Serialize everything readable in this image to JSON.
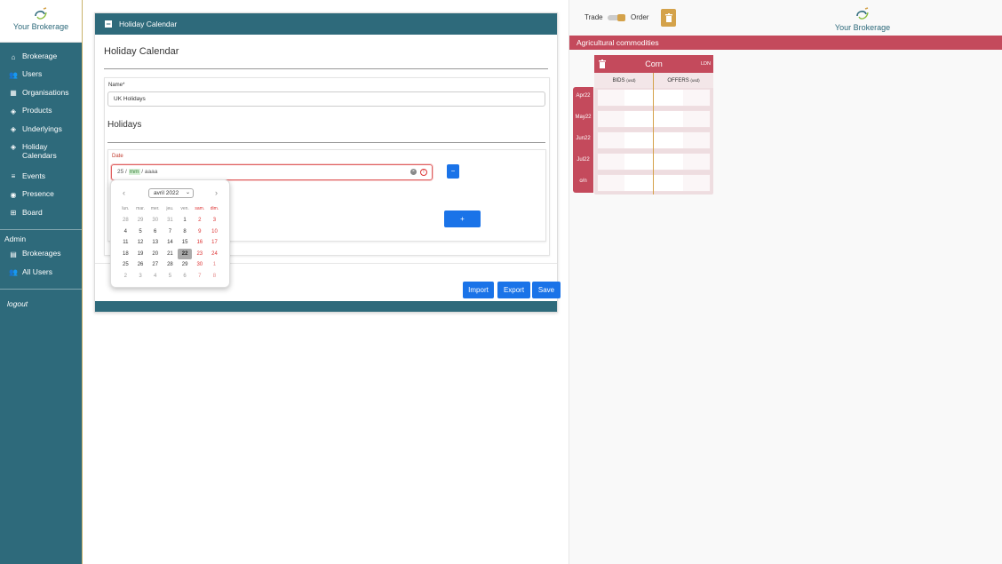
{
  "sidebar": {
    "brand": "Your Brokerage",
    "items": [
      {
        "label": "Brokerage",
        "icon": "home-icon"
      },
      {
        "label": "Users",
        "icon": "users-icon"
      },
      {
        "label": "Organisations",
        "icon": "building-icon"
      },
      {
        "label": "Products",
        "icon": "tag-icon"
      },
      {
        "label": "Underlyings",
        "icon": "tag-icon"
      },
      {
        "label": "Holiday Calendars",
        "icon": "calendar-icon"
      },
      {
        "label": "Events",
        "icon": "list-icon"
      },
      {
        "label": "Presence",
        "icon": "eye-icon"
      },
      {
        "label": "Board",
        "icon": "grid-icon"
      }
    ],
    "admin_label": "Admin",
    "admin_items": [
      {
        "label": "Brokerages",
        "icon": "server-icon"
      },
      {
        "label": "All Users",
        "icon": "users-icon"
      }
    ],
    "logout": "logout"
  },
  "card": {
    "header": "Holiday Calendar",
    "title": "Holiday Calendar",
    "name_label": "Name*",
    "name_value": "UK Holidays",
    "holidays_title": "Holidays",
    "date_label": "Date",
    "date_day": "25",
    "date_sep1": " / ",
    "date_month": "mm",
    "date_sep2": " / ",
    "date_year": "aaaa",
    "minus_btn": "−",
    "plus_btn": "+",
    "import_btn": "Import",
    "export_btn": "Export",
    "save_btn": "Save"
  },
  "datepicker": {
    "month_label": "avril 2022",
    "weekdays": [
      "lun.",
      "mar.",
      "mer.",
      "jeu.",
      "ven.",
      "sam.",
      "dim."
    ],
    "weeks": [
      [
        "28",
        "29",
        "30",
        "31",
        "1",
        "2",
        "3"
      ],
      [
        "4",
        "5",
        "6",
        "7",
        "8",
        "9",
        "10"
      ],
      [
        "11",
        "12",
        "13",
        "14",
        "15",
        "16",
        "17"
      ],
      [
        "18",
        "19",
        "20",
        "21",
        "22",
        "23",
        "24"
      ],
      [
        "25",
        "26",
        "27",
        "28",
        "29",
        "30",
        "1"
      ],
      [
        "2",
        "3",
        "4",
        "5",
        "6",
        "7",
        "8"
      ]
    ],
    "selected": "22"
  },
  "right": {
    "trade_label": "Trade",
    "order_label": "Order",
    "brand": "Your Brokerage",
    "section": "Agricultural commodities",
    "product": "Corn",
    "exchange": "LDN",
    "bids_label": "BIDS",
    "offers_label": "OFFERS",
    "unit": "(usd)",
    "tenors": [
      "Apr22",
      "May22",
      "Jun22",
      "Jul22",
      "o/n"
    ]
  },
  "colors": {
    "sidebar": "#2e6a7b",
    "accent_red": "#c44a5c",
    "accent_gold": "#d4a24a",
    "primary_button": "#1a73e8"
  }
}
